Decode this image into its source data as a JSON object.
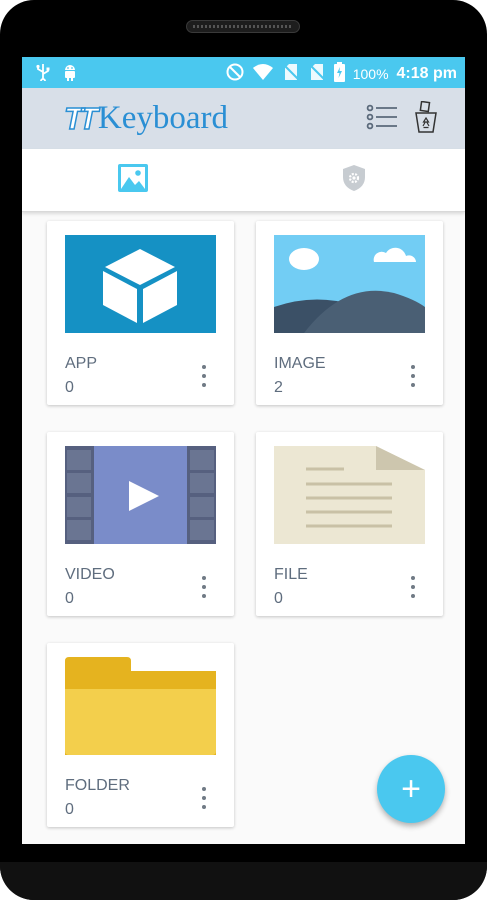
{
  "status_bar": {
    "battery_percent": "100%",
    "time": "4:18 pm",
    "icons": [
      "usb-icon",
      "android-icon",
      "do-not-disturb-icon",
      "wifi-icon",
      "no-sim-icon",
      "no-sim-icon",
      "battery-charging-icon"
    ]
  },
  "app_bar": {
    "logo_mark": "TT",
    "logo_text": "Keyboard",
    "list_view_icon": "list-icon",
    "recycle_bin_icon": "recycle-bin-icon"
  },
  "tabs": [
    {
      "icon": "image-icon",
      "active": true
    },
    {
      "icon": "shield-gear-icon",
      "active": false
    }
  ],
  "cards": [
    {
      "label": "APP",
      "count": "0",
      "thumbnail": "app-cube"
    },
    {
      "label": "IMAGE",
      "count": "2",
      "thumbnail": "landscape"
    },
    {
      "label": "VIDEO",
      "count": "0",
      "thumbnail": "film-play"
    },
    {
      "label": "FILE",
      "count": "0",
      "thumbnail": "document"
    },
    {
      "label": "FOLDER",
      "count": "0",
      "thumbnail": "folder"
    }
  ],
  "fab": {
    "label": "+"
  },
  "colors": {
    "accent": "#4ac8ef",
    "app_bar_bg": "#d8dfe8",
    "logo_blue": "#2a8fd4",
    "card_text": "#5f6d7e"
  }
}
